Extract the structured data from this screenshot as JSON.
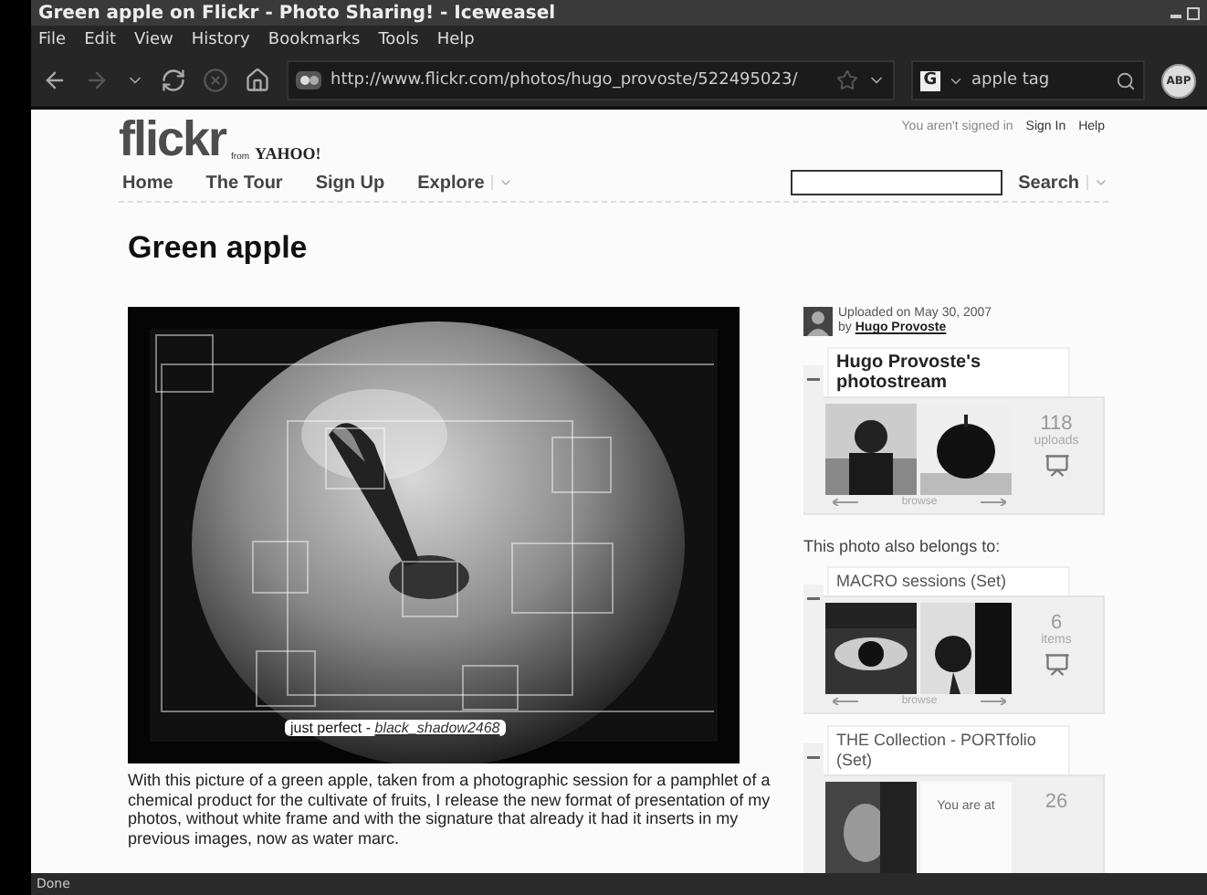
{
  "window": {
    "title": "Green apple on Flickr - Photo Sharing! - Iceweasel"
  },
  "menu": [
    "File",
    "Edit",
    "View",
    "History",
    "Bookmarks",
    "Tools",
    "Help"
  ],
  "toolbar": {
    "url": "http://www.flickr.com/photos/hugo_provoste/522495023/",
    "engine": "G",
    "search": "apple tag",
    "adblock": "ABP"
  },
  "header": {
    "logo": "flickr",
    "logo_from": "from",
    "logo_yahoo": "YAHOO!",
    "account": [
      {
        "label": "You aren't signed in",
        "kind": "text"
      },
      {
        "label": "Sign In",
        "kind": "link"
      },
      {
        "label": "Help",
        "kind": "link"
      }
    ],
    "nav": [
      {
        "label": "Home",
        "dropdown": false
      },
      {
        "label": "The Tour",
        "dropdown": false
      },
      {
        "label": "Sign Up",
        "dropdown": false
      },
      {
        "label": "Explore",
        "dropdown": true
      }
    ],
    "search_button": "Search"
  },
  "photo": {
    "title": "Green apple",
    "note_text": "just perfect - ",
    "note_author": "black_shadow2468",
    "description": "With this picture of a green apple, taken from a photographic session for a pamphlet of a chemical product for the cultivate of fruits, I release the new format of presentation of my photos, without white frame and with the signature that already it had it inserts in my previous images, now as water marc."
  },
  "uploader": {
    "uploaded": "Uploaded on May 30, 2007",
    "by": "by",
    "name": "Hugo Provoste"
  },
  "contexts": [
    {
      "title": "Hugo Provoste's photostream",
      "expanded": true,
      "count": "118",
      "unit": "uploads",
      "browse": "browse"
    },
    {
      "title": "MACRO sessions (Set)",
      "expanded": true,
      "count": "6",
      "unit": "items",
      "browse": "browse"
    },
    {
      "title": "THE Collection - PORTfolio (Set)",
      "expanded": true,
      "count": "26",
      "end_note": "You are at"
    }
  ],
  "belongs_label": "This photo also belongs to:",
  "status": "Done"
}
